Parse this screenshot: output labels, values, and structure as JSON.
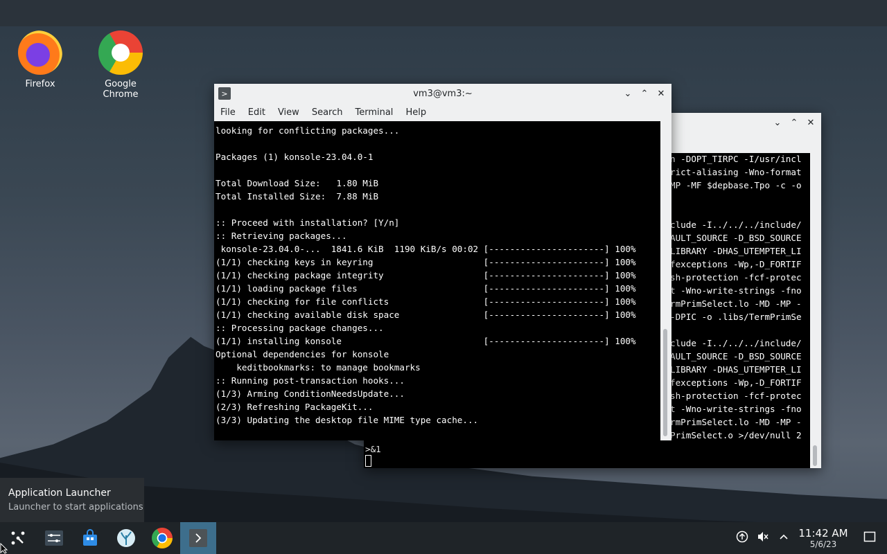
{
  "desktop": {
    "icons": [
      {
        "label": "Firefox"
      },
      {
        "label": "Google Chrome"
      }
    ]
  },
  "back_window": {
    "lines": [
      "n -DOPT_TIRPC -I/usr/incl",
      "rict-aliasing -Wno-format",
      "MP -MF $depbase.Tpo -c -o",
      "",
      "",
      "clude -I../../../include/",
      "AULT_SOURCE -D_BSD_SOURCE",
      "LIBRARY -DHAS_UTEMPTER_LI",
      "fexceptions -Wp,-D_FORTIF",
      "sh-protection -fcf-protec",
      "t -Wno-write-strings -fno",
      "rmPrimSelect.lo -MD -MP -",
      "-DPIC -o .libs/TermPrimSe",
      "",
      "clude -I../../../include/",
      "AULT_SOURCE -D_BSD_SOURCE",
      "LIBRARY -DHAS_UTEMPTER_LI",
      "fexceptions -Wp,-D_FORTIF",
      "sh-protection -fcf-protec",
      "t -Wno-write-strings -fno",
      "rmPrimSelect.lo -MD -MP -",
      "PrimSelect.o >/dev/null 2"
    ],
    "tail": ">&1"
  },
  "front_window": {
    "title": "vm3@vm3:~",
    "menu": [
      "File",
      "Edit",
      "View",
      "Search",
      "Terminal",
      "Help"
    ],
    "lines": [
      "looking for conflicting packages...",
      "",
      "Packages (1) konsole-23.04.0-1",
      "",
      "Total Download Size:   1.80 MiB",
      "Total Installed Size:  7.88 MiB",
      "",
      ":: Proceed with installation? [Y/n]",
      ":: Retrieving packages...",
      " konsole-23.04.0-...  1841.6 KiB  1190 KiB/s 00:02 [----------------------] 100%",
      "(1/1) checking keys in keyring                     [----------------------] 100%",
      "(1/1) checking package integrity                   [----------------------] 100%",
      "(1/1) loading package files                        [----------------------] 100%",
      "(1/1) checking for file conflicts                  [----------------------] 100%",
      "(1/1) checking available disk space                [----------------------] 100%",
      ":: Processing package changes...",
      "(1/1) installing konsole                           [----------------------] 100%",
      "Optional dependencies for konsole",
      "    keditbookmarks: to manage bookmarks",
      ":: Running post-transaction hooks...",
      "(1/3) Arming ConditionNeedsUpdate...",
      "(2/3) Refreshing PackageKit...",
      "(3/3) Updating the desktop file MIME type cache..."
    ]
  },
  "tooltip": {
    "title": "Application Launcher",
    "subtitle": "Launcher to start applications"
  },
  "tray": {
    "time": "11:42 AM",
    "date": "5/6/23"
  }
}
